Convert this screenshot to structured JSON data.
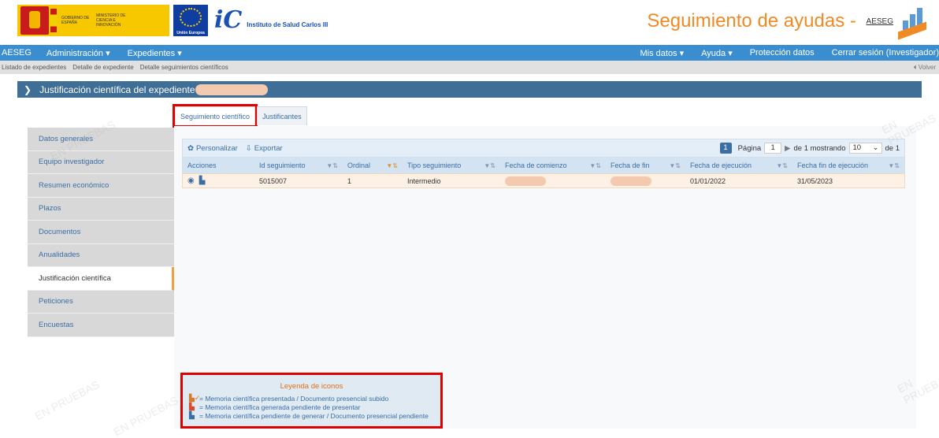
{
  "header": {
    "gobierno_text": "GOBIERNO DE ESPAÑA",
    "ministerio_text": "MINISTERIO DE CIENCIA E INNOVACIÓN",
    "eu_text": "Unión Europea",
    "isciii_text": "Instituto de Salud Carlos III",
    "app_title": "Seguimiento de ayudas - ",
    "app_brand": "AESEG"
  },
  "navbar": {
    "brand": "AESEG",
    "menu_admin": "Administración ▾",
    "menu_expedientes": "Expedientes ▾",
    "mis_datos": "Mis datos ▾",
    "ayuda": "Ayuda ▾",
    "proteccion": "Protección datos",
    "cerrar": "Cerrar sesión (Investigador)"
  },
  "subnav": {
    "crumbs": [
      "Listado de expedientes",
      "Detalle de expediente",
      "Detalle seguimientos científicos"
    ],
    "back": "⏴ Volver"
  },
  "expediente_bar": {
    "title": "Justificación científica del expediente"
  },
  "sidebar": {
    "items": [
      {
        "label": "Datos generales"
      },
      {
        "label": "Equipo investigador"
      },
      {
        "label": "Resumen económico"
      },
      {
        "label": "Plazos"
      },
      {
        "label": "Documentos"
      },
      {
        "label": "Anualidades"
      },
      {
        "label": "Justificación científica"
      },
      {
        "label": "Peticiones"
      },
      {
        "label": "Encuestas"
      }
    ],
    "active_index": 6
  },
  "tabs": {
    "items": [
      {
        "label": "Seguimiento científico"
      },
      {
        "label": "Justificantes"
      }
    ],
    "active_index": 0
  },
  "grid": {
    "toolbar": {
      "personalizar": "Personalizar",
      "exportar": "Exportar",
      "page_num": "1",
      "pagina_label": "Página",
      "pagina_value": "1",
      "de_mostrando": "de 1 mostrando",
      "per_page": "10",
      "de_total": "de 1"
    },
    "columns": [
      "Acciones",
      "Id seguimiento",
      "Ordinal",
      "Tipo seguimiento",
      "Fecha de comienzo",
      "Fecha de fin",
      "Fecha de ejecución",
      "Fecha fin de ejecución"
    ],
    "rows": [
      {
        "id": "5015007",
        "ordinal": "1",
        "tipo": "Intermedio",
        "fecha_ejecucion": "01/01/2022",
        "fecha_fin_ejecucion": "31/05/2023"
      }
    ]
  },
  "legend": {
    "title": "Leyenda de iconos",
    "items": [
      {
        "icon": "doc-check-icon",
        "text": "= Memoria científica presentada / Documento presencial subido"
      },
      {
        "icon": "doc-pending-icon",
        "text": "= Memoria científica generada pendiente de presentar"
      },
      {
        "icon": "doc-icon",
        "text": "= Memoria científica pendiente de generar / Documento presencial pendiente"
      }
    ]
  },
  "watermark_text": "EN PRUEBAS",
  "colors": {
    "navbar": "#3a8ed0",
    "expediente_bar": "#3f6e96",
    "accent_orange": "#f08a24",
    "highlight_red": "#e00000",
    "row_bg": "#fcf1e4"
  }
}
